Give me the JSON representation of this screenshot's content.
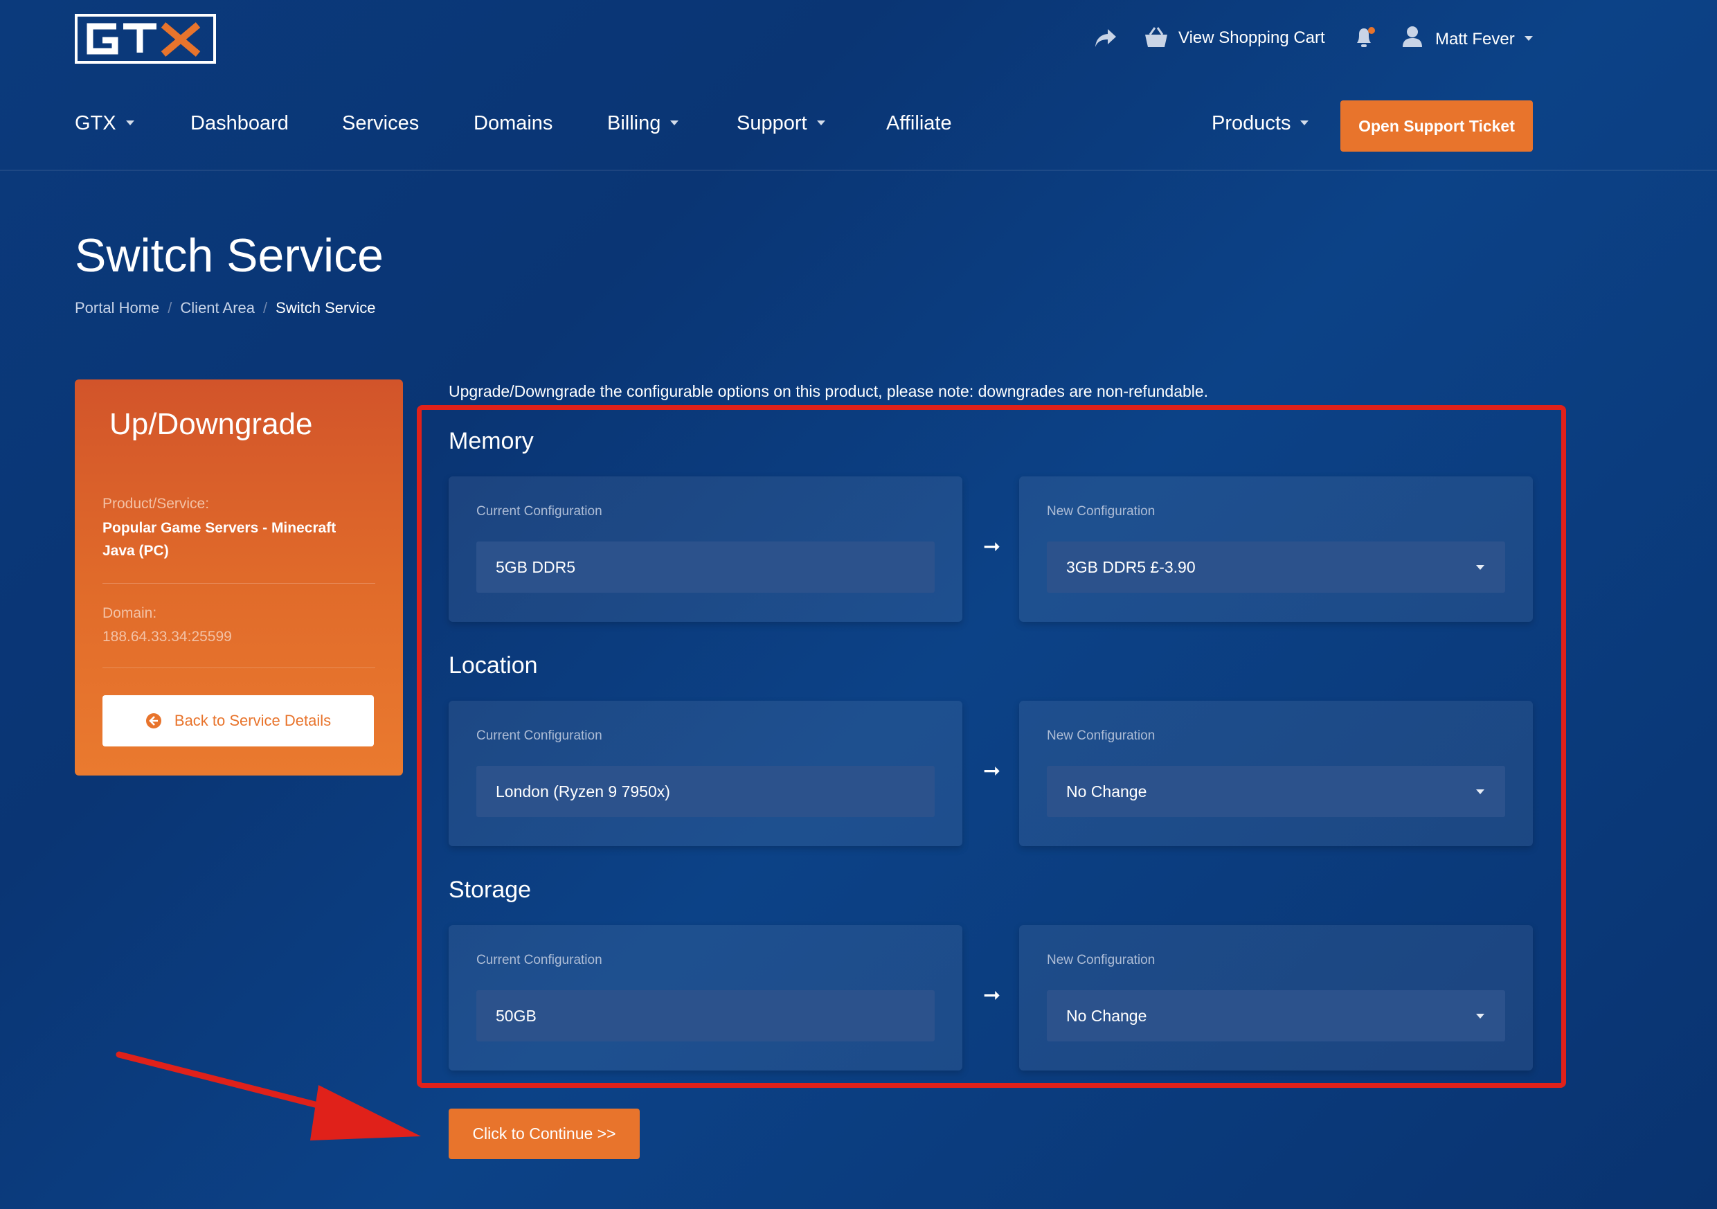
{
  "brand": {
    "logo_text": "GTX"
  },
  "topbar": {
    "cart_label": "View Shopping Cart",
    "user_name": "Matt Fever"
  },
  "nav": {
    "items": [
      {
        "label": "GTX"
      },
      {
        "label": "Dashboard"
      },
      {
        "label": "Services"
      },
      {
        "label": "Domains"
      },
      {
        "label": "Billing"
      },
      {
        "label": "Support"
      },
      {
        "label": "Affiliate"
      }
    ],
    "products_label": "Products",
    "ticket_button": "Open Support Ticket"
  },
  "page": {
    "title": "Switch Service",
    "breadcrumb": [
      "Portal Home",
      "Client Area",
      "Switch Service"
    ]
  },
  "sidebar": {
    "title": "Up/Downgrade",
    "product_label": "Product/Service:",
    "product_value": "Popular Game Servers - Minecraft Java (PC)",
    "domain_label": "Domain:",
    "domain_value": "188.64.33.34:25599",
    "back_button": "Back to Service Details"
  },
  "main": {
    "note": "Upgrade/Downgrade the configurable options on this product, please note: downgrades are non-refundable.",
    "current_label": "Current Configuration",
    "new_label": "New Configuration",
    "arrow": "➞",
    "options": [
      {
        "name": "Memory",
        "current": "5GB DDR5",
        "new": "3GB DDR5 £-3.90"
      },
      {
        "name": "Location",
        "current": "London (Ryzen 9 7950x)",
        "new": "No Change"
      },
      {
        "name": "Storage",
        "current": "50GB",
        "new": "No Change"
      }
    ],
    "continue_button": "Click to Continue >>"
  },
  "colors": {
    "background": "#0b3a7c",
    "accent_orange": "#e8742c",
    "highlight_red": "#e0211a"
  },
  "icons": [
    "share-icon",
    "basket-icon",
    "bell-icon",
    "user-icon",
    "arrow-circle-left-icon",
    "arrow-right-icon"
  ]
}
